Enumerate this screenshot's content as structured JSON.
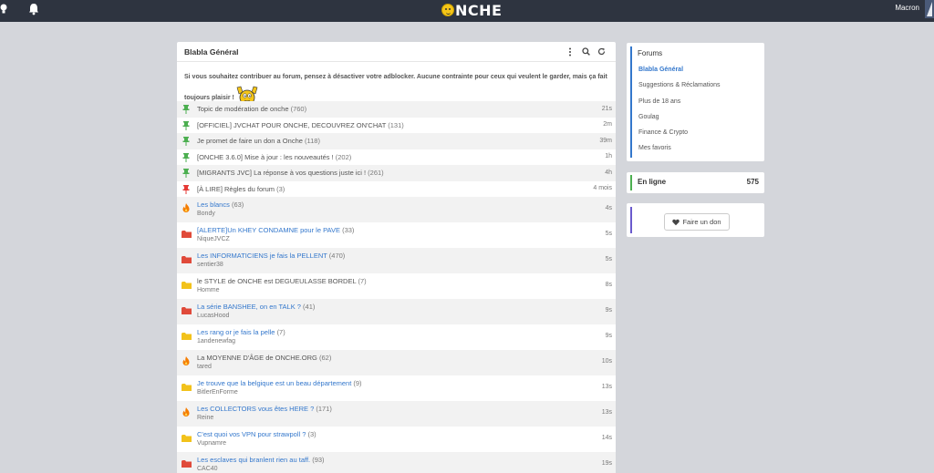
{
  "topbar": {
    "logo_text": "NCHE",
    "user_name": "Macron"
  },
  "panel": {
    "title": "Blabla Général",
    "notice_text": "Si vous souhaitez contribuer au forum, pensez à désactiver votre adblocker. Aucune contrainte pour ceux qui veulent le garder, mais ça fait toujours plaisir !"
  },
  "topics": [
    {
      "icon": "green-pin",
      "title": "Topic de modération de onche",
      "count": "(760)",
      "author": "",
      "time": "21s",
      "blue": false
    },
    {
      "icon": "green-pin",
      "title": "[OFFICIEL] JVCHAT POUR ONCHE, DECOUVREZ ON'CHAT",
      "count": "(131)",
      "author": "",
      "time": "2m",
      "blue": false
    },
    {
      "icon": "green-pin",
      "title": "Je promet de faire un don a Onche",
      "count": "(118)",
      "author": "",
      "time": "39m",
      "blue": false
    },
    {
      "icon": "green-pin",
      "title": "[ONCHE 3.6.0] Mise à jour : les nouveautés !",
      "count": "(202)",
      "author": "",
      "time": "1h",
      "blue": false
    },
    {
      "icon": "green-pin",
      "title": "[MIGRANTS JVC] La réponse à vos questions juste ici !",
      "count": "(261)",
      "author": "",
      "time": "4h",
      "blue": false
    },
    {
      "icon": "red-pin",
      "title": "[À LIRE] Règles du forum",
      "count": "(3)",
      "author": "",
      "time": "4 mois",
      "blue": false
    },
    {
      "icon": "fire",
      "title": "Les blancs",
      "count": "(63)",
      "author": "Bondy",
      "time": "4s",
      "blue": true
    },
    {
      "icon": "red-folder",
      "title": "[ALERTE]Un KHEY CONDAMNE pour le PAVE",
      "count": "(33)",
      "author": "NiqueJVCZ",
      "time": "5s",
      "blue": true
    },
    {
      "icon": "red-folder",
      "title": "Les INFORMATICIENS je fais la PELLENT",
      "count": "(470)",
      "author": "sentier38",
      "time": "5s",
      "blue": true
    },
    {
      "icon": "yellow-folder",
      "title": "le STYLE de ONCHE est DEGUEULASSE BORDEL",
      "count": "(7)",
      "author": "Homme",
      "time": "8s",
      "blue": false
    },
    {
      "icon": "red-folder",
      "title": "La série BANSHEE, on en TALK ?",
      "count": "(41)",
      "author": "LucasHood",
      "time": "9s",
      "blue": true
    },
    {
      "icon": "yellow-folder",
      "title": "Les rang or je fais la pelle",
      "count": "(7)",
      "author": "1andenewfag",
      "time": "9s",
      "blue": true
    },
    {
      "icon": "fire",
      "title": "La MOYENNE D'ÂGE de ONCHE.ORG",
      "count": "(62)",
      "author": "tared",
      "time": "10s",
      "blue": false
    },
    {
      "icon": "yellow-folder",
      "title": "Je trouve que la belgique est un beau département",
      "count": "(9)",
      "author": "BitlerEnForme",
      "time": "13s",
      "blue": true
    },
    {
      "icon": "fire",
      "title": "Les COLLECTORS vous êtes HERE ?",
      "count": "(171)",
      "author": "Reine",
      "time": "13s",
      "blue": true
    },
    {
      "icon": "yellow-folder",
      "title": "C'est quoi vos VPN pour strawpoll ?",
      "count": "(3)",
      "author": "Vupnamre",
      "time": "14s",
      "blue": true
    },
    {
      "icon": "red-folder",
      "title": "Les esclaves qui branlent rien au taff.",
      "count": "(93)",
      "author": "CAC40",
      "time": "19s",
      "blue": true
    }
  ],
  "sidebar": {
    "forums_title": "Forums",
    "forums": [
      "Blabla Général",
      "Suggestions & Réclamations",
      "Plus de 18 ans",
      "Goulag",
      "Finance & Crypto",
      "Mes favoris"
    ],
    "online_label": "En ligne",
    "online_count": "575",
    "donate_label": "Faire un don"
  },
  "colors": {
    "topbar": "#2e3440",
    "accent_blue": "#3377cc",
    "green_pin": "#4caf50",
    "red_pin": "#e53935",
    "red_folder": "#e04a3a",
    "yellow_folder": "#f2c21b",
    "fire": "#f57c00"
  }
}
